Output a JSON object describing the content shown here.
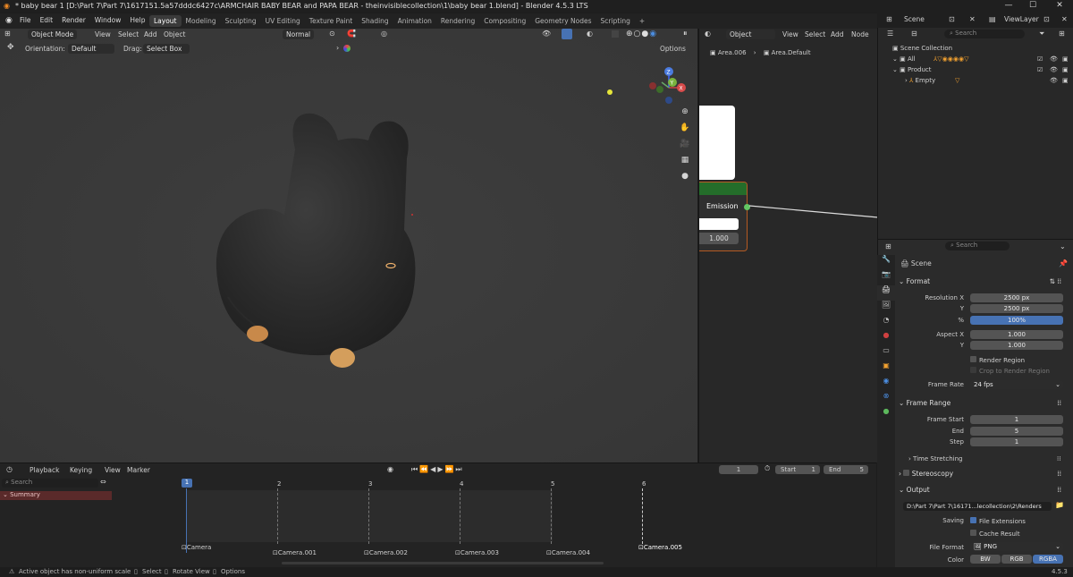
{
  "window": {
    "title": "* baby bear 1 [D:\\Part 7\\Part 7\\1617151.5a57dddc6427c\\ARMCHAIR BABY BEAR and PAPA BEAR - theinvisiblecollection\\1\\baby bear 1.blend] - Blender 4.5.3 LTS",
    "minimize": "—",
    "maximize": "☐",
    "close": "✕"
  },
  "menu": {
    "items": [
      "File",
      "Edit",
      "Render",
      "Window",
      "Help"
    ]
  },
  "workspaces": {
    "tabs": [
      "Layout",
      "Modeling",
      "Sculpting",
      "UV Editing",
      "Texture Paint",
      "Shading",
      "Animation",
      "Rendering",
      "Compositing",
      "Geometry Nodes",
      "Scripting",
      "+"
    ],
    "active": "Layout"
  },
  "top_right": {
    "scene": "Scene",
    "viewlayer": "ViewLayer"
  },
  "viewport": {
    "mode": "Object Mode",
    "menus": [
      "View",
      "Select",
      "Add",
      "Object"
    ],
    "orientation_label": "Orientation:",
    "orientation_value": "Default",
    "drag_label": "Drag:",
    "drag_value": "Select Box",
    "transform": "Normal",
    "options": "Options",
    "gizmo": {
      "x": "X",
      "y": "Y",
      "z": "Z"
    }
  },
  "node_editor": {
    "mode": "Object",
    "menus": [
      "View",
      "Select",
      "Add",
      "Node"
    ],
    "breadcrumb_1": "Area.006",
    "breadcrumb_2": "Area.Default",
    "node_label": "Emission",
    "node_value": "1.000"
  },
  "outliner": {
    "search_placeholder": "Search",
    "collection": "Scene Collection",
    "items": [
      {
        "label": "All"
      },
      {
        "label": "Product"
      },
      {
        "label": "Empty"
      }
    ]
  },
  "properties": {
    "search_placeholder": "Search",
    "scene": "Scene",
    "format_title": "Format",
    "res_x_label": "Resolution X",
    "res_x": "2500 px",
    "y_label": "Y",
    "res_y": "2500 px",
    "pct_label": "%",
    "pct": "100%",
    "aspect_x_label": "Aspect X",
    "aspect_x": "1.000",
    "aspect_y_label": "Y",
    "aspect_y": "1.000",
    "render_region": "Render Region",
    "crop_region": "Crop to Render Region",
    "frame_rate_label": "Frame Rate",
    "frame_rate": "24 fps",
    "frame_range_title": "Frame Range",
    "frame_start_label": "Frame Start",
    "frame_start": "1",
    "end_label": "End",
    "end": "5",
    "step_label": "Step",
    "step": "1",
    "time_stretching": "Time Stretching",
    "stereoscopy": "Stereoscopy",
    "output_title": "Output",
    "output_path": "D:\\Part 7\\Part 7\\16171...lecollection\\2\\Renders",
    "saving_label": "Saving",
    "file_ext": "File Extensions",
    "cache_result": "Cache Result",
    "file_format_label": "File Format",
    "file_format": "PNG",
    "color_label": "Color",
    "color_opts": [
      "BW",
      "RGB",
      "RGBA"
    ]
  },
  "timeline": {
    "menus": [
      "Playback",
      "Keying",
      "View",
      "Marker"
    ],
    "current_frame": "1",
    "start_label": "Start",
    "start": "1",
    "end_label": "End",
    "end": "5",
    "search_placeholder": "Search",
    "summary": "Summary",
    "frames": [
      "1",
      "2",
      "3",
      "4",
      "5",
      "6"
    ],
    "cameras": [
      "Camera",
      "Camera.001",
      "Camera.002",
      "Camera.003",
      "Camera.004",
      "Camera.005"
    ]
  },
  "statusbar": {
    "message": "Active object has non-uniform scale",
    "select": "Select",
    "rotate": "Rotate View",
    "options": "Options",
    "version": "4.5.3"
  },
  "colors": {
    "accent": "#4772b3",
    "node_header": "#246d2a",
    "highlight": "#f0b26c"
  }
}
